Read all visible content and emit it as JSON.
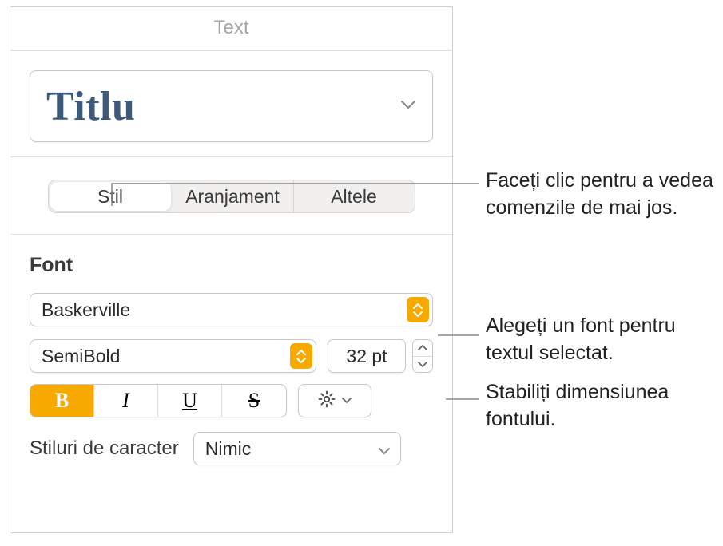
{
  "header": {
    "title": "Text"
  },
  "style_preview": {
    "name": "Titlu"
  },
  "tabs": {
    "items": [
      {
        "label": "Stil",
        "active": true
      },
      {
        "label": "Aranjament",
        "active": false
      },
      {
        "label": "Altele",
        "active": false
      }
    ]
  },
  "font": {
    "section_label": "Font",
    "family": "Baskerville",
    "weight": "SemiBold",
    "size": "32 pt",
    "buttons": {
      "bold": "B",
      "italic": "I",
      "underline": "U",
      "strike": "S"
    },
    "char_styles_label": "Stiluri de caracter",
    "char_styles_value": "Nimic"
  },
  "callouts": {
    "c1": "Faceți clic pentru a vedea comenzile de mai jos.",
    "c2": "Alegeți un font pentru textul selectat.",
    "c3": "Stabiliți dimensiunea fontului."
  }
}
